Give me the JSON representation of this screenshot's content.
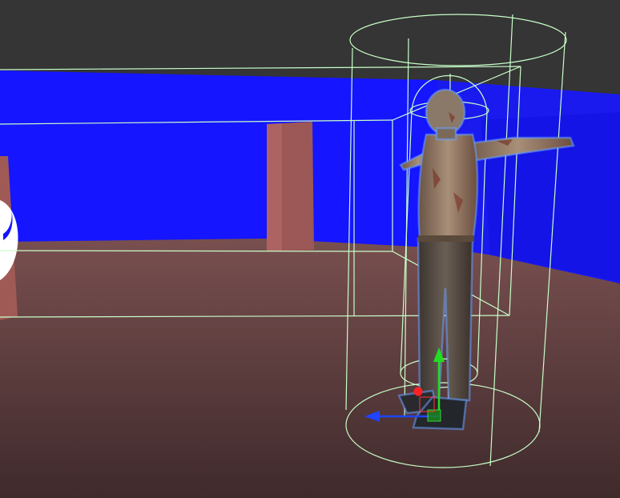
{
  "viewport": {
    "kind": "3d-scene-view",
    "colors": {
      "sky": "#3e3e3e",
      "ceiling": "#2c2c2c",
      "wall": "#1515ff",
      "wall_shade": "#1010d8",
      "floor": "#5a3a3a",
      "floor_far": "#7a5050",
      "pillar": "#9c5757",
      "pillar_shade": "#7d4343",
      "gizmo_wire": "#c8ffc8",
      "axis_y": "#22dd22",
      "axis_x": "#1f44ff",
      "pivot": "#ff2222",
      "character_outline": "#6aa0ff"
    },
    "objects": [
      {
        "name": "character-zombie",
        "pose": "T-pose"
      },
      {
        "name": "collider-capsule-inner"
      },
      {
        "name": "collider-capsule-outer"
      },
      {
        "name": "collider-box"
      },
      {
        "name": "transform-gizmo"
      }
    ]
  }
}
